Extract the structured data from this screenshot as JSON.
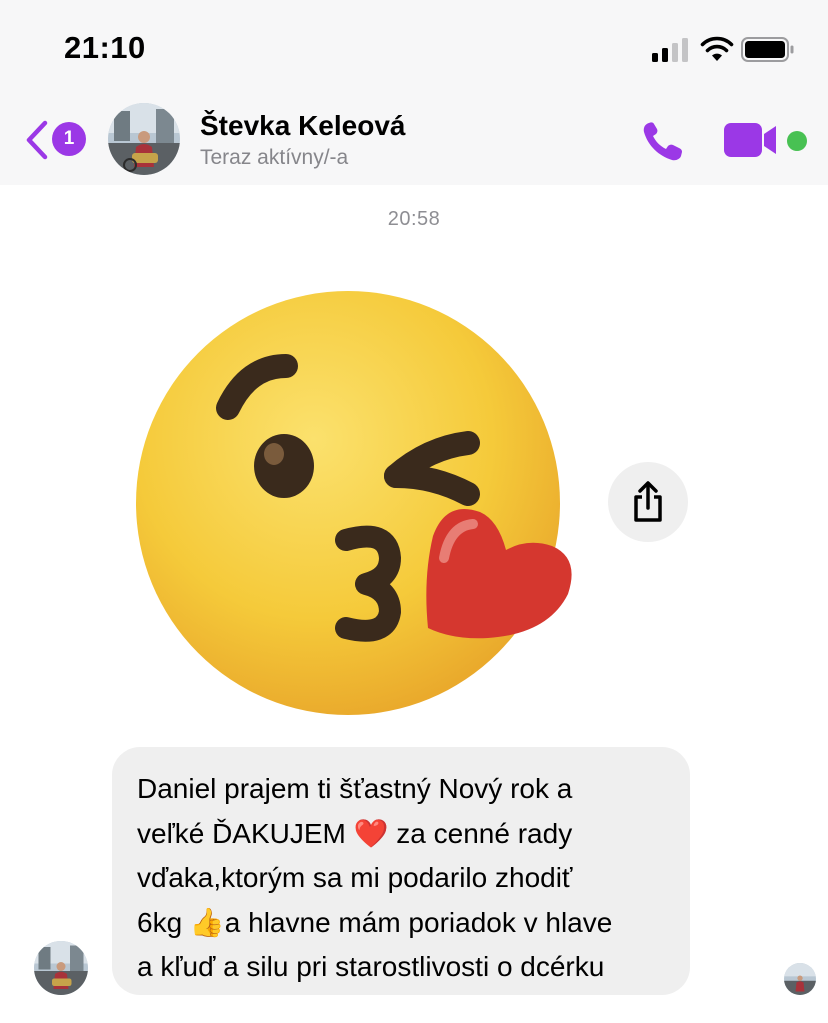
{
  "status_bar": {
    "time": "21:10",
    "signal_icon": "cellular-signal-icon",
    "wifi_icon": "wifi-icon",
    "battery_icon": "battery-icon"
  },
  "header": {
    "back_icon": "chevron-left-icon",
    "unread_count": "1",
    "contact_name": "Števka Keleová",
    "contact_status": "Teraz aktívny/-a",
    "call_icon": "phone-icon",
    "video_icon": "video-camera-icon",
    "online": true
  },
  "chat": {
    "timestamp": "20:58",
    "sticker": "face-blowing-a-kiss-emoji",
    "share_icon": "share-icon",
    "message_lines": [
      "Daniel prajem ti šťastný Nový rok a",
      "veľké ĎAKUJEM ❤️ za cenné rady",
      "vďaka,ktorým sa mi podarilo zhodiť",
      "6kg 👍a hlavne mám poriadok v hlave",
      "a kľuď a silu pri starostlivosti o dcérku"
    ]
  },
  "colors": {
    "accent": "#9b38e6",
    "online_dot": "#48c153",
    "bubble_bg": "#efefef",
    "header_bg": "#f7f7f8",
    "muted_text": "#8e8e93"
  }
}
